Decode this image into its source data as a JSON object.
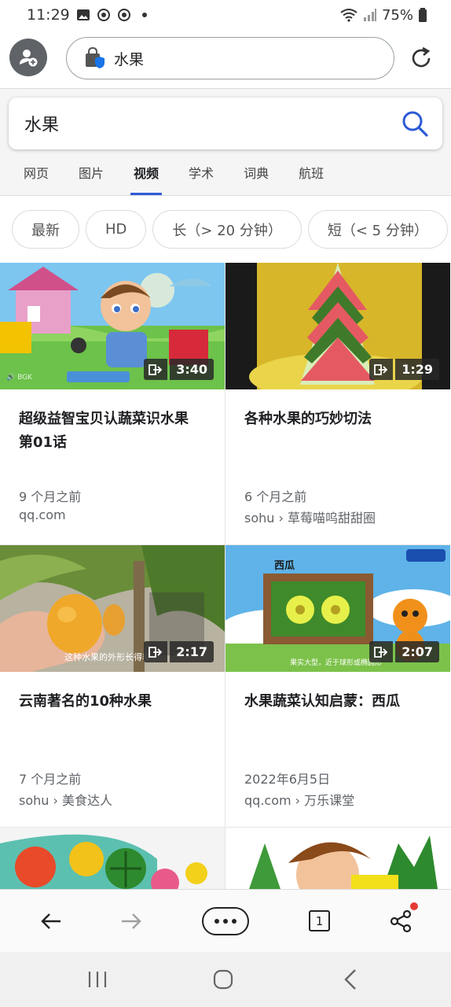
{
  "status_bar": {
    "time": "11:29",
    "battery": "75%"
  },
  "address_bar": {
    "url_text": "水果"
  },
  "search": {
    "query": "水果"
  },
  "tabs": [
    {
      "label": "网页",
      "active": false
    },
    {
      "label": "图片",
      "active": false
    },
    {
      "label": "视频",
      "active": true
    },
    {
      "label": "学术",
      "active": false
    },
    {
      "label": "词典",
      "active": false
    },
    {
      "label": "航班",
      "active": false
    }
  ],
  "filters": [
    "最新",
    "HD",
    "长（> 20 分钟）",
    "短（< 5 分钟）"
  ],
  "videos": [
    {
      "title": "超级益智宝贝认蔬菜识水果 第01话",
      "duration": "3:40",
      "date": "9 个月之前",
      "source": "qq.com",
      "thumb_watermark": "🔊 BGK"
    },
    {
      "title": "各种水果的巧妙切法",
      "duration": "1:29",
      "date": "6 个月之前",
      "source": "sohu › 草莓喵呜甜甜圈"
    },
    {
      "title": "云南著名的10种水果",
      "duration": "2:17",
      "date": "7 个月之前",
      "source": "sohu › 美食达人",
      "thumb_caption": "这种水果的外形长得非"
    },
    {
      "title": "水果蔬菜认知启蒙：西瓜",
      "duration": "2:07",
      "date": "2022年6月5日",
      "source": "qq.com › 万乐课堂",
      "thumb_heading": "西瓜",
      "thumb_caption": "果实大型，近于球形或椭圆形"
    }
  ],
  "bottom_bar": {
    "tab_count": "1"
  },
  "colors": {
    "accent": "#2d5bd7",
    "notification": "#e53935"
  }
}
